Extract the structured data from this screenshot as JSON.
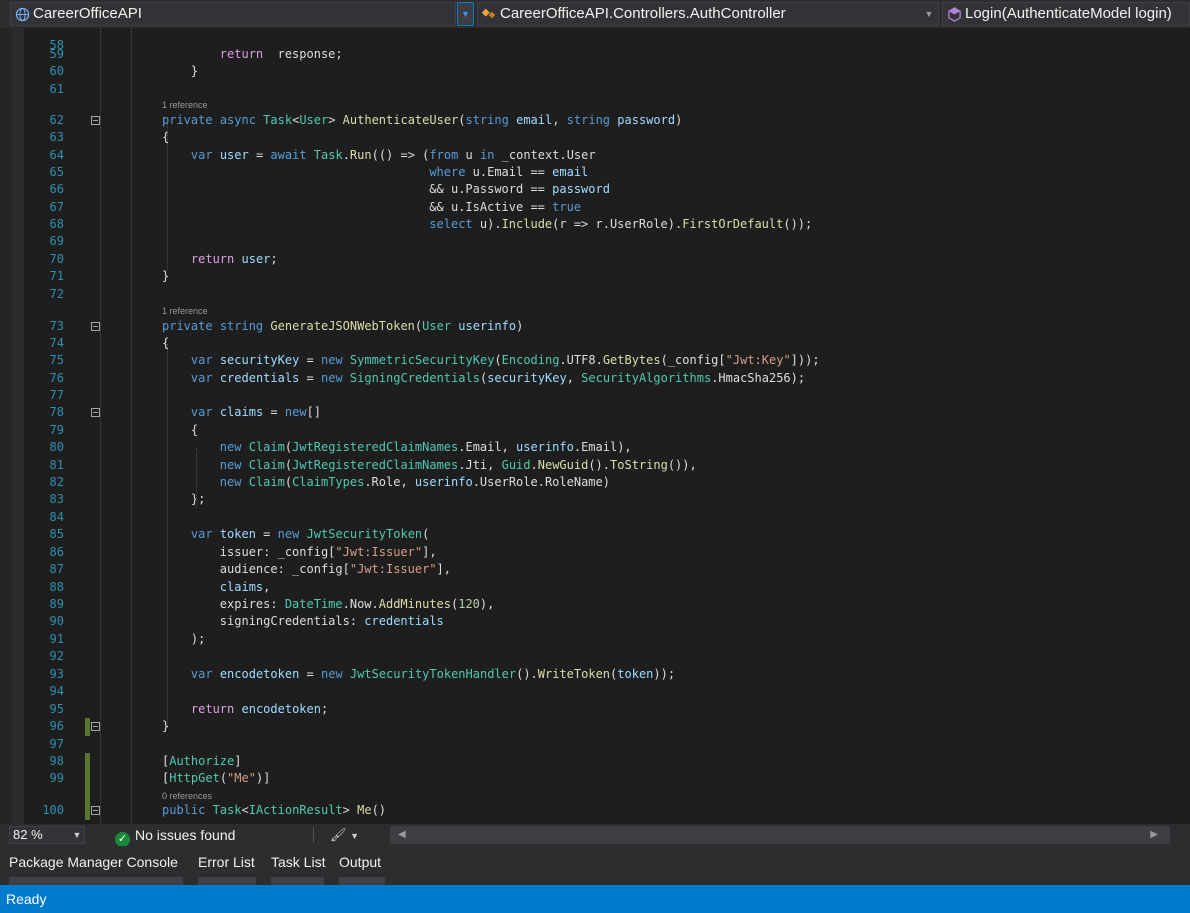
{
  "nav": {
    "project": "CareerOfficeAPI",
    "type": "CareerOfficeAPI.Controllers.AuthController",
    "member": "Login(AuthenticateModel login)"
  },
  "code_lines": [
    {
      "num": "58",
      "ref": "",
      "segs": []
    },
    {
      "num": "59",
      "ref": "",
      "segs": [
        [
          "ind",
          "        "
        ],
        [
          "ctl",
          "return"
        ],
        [
          "",
          "  response;"
        ]
      ]
    },
    {
      "num": "60",
      "ref": "",
      "segs": [
        [
          "",
          "    }"
        ]
      ]
    },
    {
      "num": "61",
      "ref": "",
      "segs": []
    },
    {
      "num": "62",
      "ref": "1 reference",
      "segs": [
        [
          "kw",
          "private"
        ],
        [
          "",
          " "
        ],
        [
          "kw",
          "async"
        ],
        [
          "",
          " "
        ],
        [
          "ty",
          "Task"
        ],
        [
          "",
          "<"
        ],
        [
          "ty",
          "User"
        ],
        [
          "",
          "> "
        ],
        [
          "fn",
          "AuthenticateUser"
        ],
        [
          "",
          "("
        ],
        [
          "kw",
          "string"
        ],
        [
          "",
          " "
        ],
        [
          "pr",
          "email"
        ],
        [
          "",
          ", "
        ],
        [
          "kw",
          "string"
        ],
        [
          "",
          " "
        ],
        [
          "pr",
          "password"
        ],
        [
          "",
          ")"
        ]
      ]
    },
    {
      "num": "63",
      "ref": "",
      "segs": [
        [
          "",
          "{"
        ]
      ]
    },
    {
      "num": "64",
      "ref": "",
      "segs": [
        [
          "",
          "    "
        ],
        [
          "kw",
          "var"
        ],
        [
          "",
          " "
        ],
        [
          "pr",
          "user"
        ],
        [
          "",
          " = "
        ],
        [
          "kw",
          "await"
        ],
        [
          "",
          " "
        ],
        [
          "ty",
          "Task"
        ],
        [
          "",
          "."
        ],
        [
          "fn",
          "Run"
        ],
        [
          "",
          "(() => ("
        ],
        [
          "kw",
          "from"
        ],
        [
          "",
          " u "
        ],
        [
          "kw",
          "in"
        ],
        [
          "",
          " _context.User"
        ]
      ]
    },
    {
      "num": "65",
      "ref": "",
      "segs": [
        [
          "",
          "                                     "
        ],
        [
          "kw",
          "where"
        ],
        [
          "",
          " u.Email == "
        ],
        [
          "pr",
          "email"
        ]
      ]
    },
    {
      "num": "66",
      "ref": "",
      "segs": [
        [
          "",
          "                                     && u.Password == "
        ],
        [
          "pr",
          "password"
        ]
      ]
    },
    {
      "num": "67",
      "ref": "",
      "segs": [
        [
          "",
          "                                     && u.IsActive == "
        ],
        [
          "kw",
          "true"
        ]
      ]
    },
    {
      "num": "68",
      "ref": "",
      "segs": [
        [
          "",
          "                                     "
        ],
        [
          "kw",
          "select"
        ],
        [
          "",
          " u)."
        ],
        [
          "fn",
          "Include"
        ],
        [
          "",
          "(r => r.UserRole)."
        ],
        [
          "fn",
          "FirstOrDefault"
        ],
        [
          "",
          "());"
        ]
      ]
    },
    {
      "num": "69",
      "ref": "",
      "segs": []
    },
    {
      "num": "70",
      "ref": "",
      "segs": [
        [
          "",
          "    "
        ],
        [
          "ctl",
          "return"
        ],
        [
          "",
          " "
        ],
        [
          "pr",
          "user"
        ],
        [
          "",
          ";"
        ]
      ]
    },
    {
      "num": "71",
      "ref": "",
      "segs": [
        [
          "",
          "}"
        ]
      ]
    },
    {
      "num": "72",
      "ref": "",
      "segs": []
    },
    {
      "num": "73",
      "ref": "1 reference",
      "segs": [
        [
          "kw",
          "private"
        ],
        [
          "",
          " "
        ],
        [
          "kw",
          "string"
        ],
        [
          "",
          " "
        ],
        [
          "fn",
          "GenerateJSONWebToken"
        ],
        [
          "",
          "("
        ],
        [
          "ty",
          "User"
        ],
        [
          "",
          " "
        ],
        [
          "pr",
          "userinfo"
        ],
        [
          "",
          ")"
        ]
      ]
    },
    {
      "num": "74",
      "ref": "",
      "segs": [
        [
          "",
          "{"
        ]
      ]
    },
    {
      "num": "75",
      "ref": "",
      "segs": [
        [
          "",
          "    "
        ],
        [
          "kw",
          "var"
        ],
        [
          "",
          " "
        ],
        [
          "pr",
          "securityKey"
        ],
        [
          "",
          " = "
        ],
        [
          "kw",
          "new"
        ],
        [
          "",
          " "
        ],
        [
          "ty",
          "SymmetricSecurityKey"
        ],
        [
          "",
          "("
        ],
        [
          "ty",
          "Encoding"
        ],
        [
          "",
          ".UTF8."
        ],
        [
          "fn",
          "GetBytes"
        ],
        [
          "",
          "(_config["
        ],
        [
          "st",
          "\"Jwt:Key\""
        ],
        [
          "",
          "]));"
        ]
      ]
    },
    {
      "num": "76",
      "ref": "",
      "segs": [
        [
          "",
          "    "
        ],
        [
          "kw",
          "var"
        ],
        [
          "",
          " "
        ],
        [
          "pr",
          "credentials"
        ],
        [
          "",
          " = "
        ],
        [
          "kw",
          "new"
        ],
        [
          "",
          " "
        ],
        [
          "ty",
          "SigningCredentials"
        ],
        [
          "",
          "("
        ],
        [
          "pr",
          "securityKey"
        ],
        [
          "",
          ", "
        ],
        [
          "ty",
          "SecurityAlgorithms"
        ],
        [
          "",
          ".HmacSha256);"
        ]
      ]
    },
    {
      "num": "77",
      "ref": "",
      "segs": []
    },
    {
      "num": "78",
      "ref": "",
      "segs": [
        [
          "",
          "    "
        ],
        [
          "kw",
          "var"
        ],
        [
          "",
          " "
        ],
        [
          "pr",
          "claims"
        ],
        [
          "",
          " = "
        ],
        [
          "kw",
          "new"
        ],
        [
          "",
          "[]"
        ]
      ]
    },
    {
      "num": "79",
      "ref": "",
      "segs": [
        [
          "",
          "    {"
        ]
      ]
    },
    {
      "num": "80",
      "ref": "",
      "segs": [
        [
          "",
          "        "
        ],
        [
          "kw",
          "new"
        ],
        [
          "",
          " "
        ],
        [
          "ty",
          "Claim"
        ],
        [
          "",
          "("
        ],
        [
          "ty",
          "JwtRegisteredClaimNames"
        ],
        [
          "",
          ".Email, "
        ],
        [
          "pr",
          "userinfo"
        ],
        [
          "",
          ".Email),"
        ]
      ]
    },
    {
      "num": "81",
      "ref": "",
      "segs": [
        [
          "",
          "        "
        ],
        [
          "kw",
          "new"
        ],
        [
          "",
          " "
        ],
        [
          "ty",
          "Claim"
        ],
        [
          "",
          "("
        ],
        [
          "ty",
          "JwtRegisteredClaimNames"
        ],
        [
          "",
          ".Jti, "
        ],
        [
          "ty",
          "Guid"
        ],
        [
          "",
          "."
        ],
        [
          "fn",
          "NewGuid"
        ],
        [
          "",
          "()."
        ],
        [
          "fn",
          "ToString"
        ],
        [
          "",
          "()),"
        ]
      ]
    },
    {
      "num": "82",
      "ref": "",
      "segs": [
        [
          "",
          "        "
        ],
        [
          "kw",
          "new"
        ],
        [
          "",
          " "
        ],
        [
          "ty",
          "Claim"
        ],
        [
          "",
          "("
        ],
        [
          "ty",
          "ClaimTypes"
        ],
        [
          "",
          ".Role, "
        ],
        [
          "pr",
          "userinfo"
        ],
        [
          "",
          ".UserRole.RoleName)"
        ]
      ]
    },
    {
      "num": "83",
      "ref": "",
      "segs": [
        [
          "",
          "    };"
        ]
      ]
    },
    {
      "num": "84",
      "ref": "",
      "segs": []
    },
    {
      "num": "85",
      "ref": "",
      "segs": [
        [
          "",
          "    "
        ],
        [
          "kw",
          "var"
        ],
        [
          "",
          " "
        ],
        [
          "pr",
          "token"
        ],
        [
          "",
          " = "
        ],
        [
          "kw",
          "new"
        ],
        [
          "",
          " "
        ],
        [
          "ty",
          "JwtSecurityToken"
        ],
        [
          "",
          "("
        ]
      ]
    },
    {
      "num": "86",
      "ref": "",
      "segs": [
        [
          "",
          "        issuer: _config["
        ],
        [
          "st",
          "\"Jwt:Issuer\""
        ],
        [
          "",
          "],"
        ]
      ]
    },
    {
      "num": "87",
      "ref": "",
      "segs": [
        [
          "",
          "        audience: _config["
        ],
        [
          "st",
          "\"Jwt:Issuer\""
        ],
        [
          "",
          "],"
        ]
      ]
    },
    {
      "num": "88",
      "ref": "",
      "segs": [
        [
          "",
          "        "
        ],
        [
          "pr",
          "claims"
        ],
        [
          "",
          ","
        ]
      ]
    },
    {
      "num": "89",
      "ref": "",
      "segs": [
        [
          "",
          "        expires: "
        ],
        [
          "ty",
          "DateTime"
        ],
        [
          "",
          ".Now."
        ],
        [
          "fn",
          "AddMinutes"
        ],
        [
          "",
          "("
        ],
        [
          "nm",
          "120"
        ],
        [
          "",
          "),"
        ]
      ]
    },
    {
      "num": "90",
      "ref": "",
      "segs": [
        [
          "",
          "        signingCredentials: "
        ],
        [
          "pr",
          "credentials"
        ]
      ]
    },
    {
      "num": "91",
      "ref": "",
      "segs": [
        [
          "",
          "    );"
        ]
      ]
    },
    {
      "num": "92",
      "ref": "",
      "segs": []
    },
    {
      "num": "93",
      "ref": "",
      "segs": [
        [
          "",
          "    "
        ],
        [
          "kw",
          "var"
        ],
        [
          "",
          " "
        ],
        [
          "pr",
          "encodetoken"
        ],
        [
          "",
          " = "
        ],
        [
          "kw",
          "new"
        ],
        [
          "",
          " "
        ],
        [
          "ty",
          "JwtSecurityTokenHandler"
        ],
        [
          "",
          "()."
        ],
        [
          "fn",
          "WriteToken"
        ],
        [
          "",
          "("
        ],
        [
          "pr",
          "token"
        ],
        [
          "",
          "));"
        ]
      ]
    },
    {
      "num": "94",
      "ref": "",
      "segs": []
    },
    {
      "num": "95",
      "ref": "",
      "segs": [
        [
          "",
          "    "
        ],
        [
          "ctl",
          "return"
        ],
        [
          "",
          " "
        ],
        [
          "pr",
          "encodetoken"
        ],
        [
          "",
          ";"
        ]
      ]
    },
    {
      "num": "96",
      "ref": "",
      "segs": [
        [
          "",
          "}"
        ]
      ]
    },
    {
      "num": "97",
      "ref": "",
      "segs": []
    },
    {
      "num": "98",
      "ref": "",
      "segs": [
        [
          "",
          "["
        ],
        [
          "ty",
          "Authorize"
        ],
        [
          "",
          "]"
        ]
      ]
    },
    {
      "num": "99",
      "ref": "",
      "segs": [
        [
          "",
          "["
        ],
        [
          "ty",
          "HttpGet"
        ],
        [
          "",
          "("
        ],
        [
          "st",
          "\"Me\""
        ],
        [
          "",
          ")]"
        ]
      ]
    },
    {
      "num": "100",
      "ref": "0 references",
      "segs": [
        [
          "kw",
          "public"
        ],
        [
          "",
          " "
        ],
        [
          "ty",
          "Task"
        ],
        [
          "",
          "<"
        ],
        [
          "ty",
          "IActionResult"
        ],
        [
          "",
          "> "
        ],
        [
          "fn",
          "Me"
        ],
        [
          "",
          "()"
        ]
      ]
    }
  ],
  "footer": {
    "zoom": "82 %",
    "issues": "No issues found"
  },
  "toolwindows": {
    "tabs": [
      "Package Manager Console",
      "Error List",
      "Task List",
      "Output"
    ]
  },
  "status": {
    "text": "Ready"
  },
  "colors": {
    "accent": "#007acc",
    "editor_bg": "#1e1e1e",
    "line_number": "#2b91af",
    "change_marker": "#577430",
    "keyword": "#569cd6",
    "type": "#4ec9b0",
    "method": "#dcdcaa",
    "string": "#d69d85",
    "control": "#d8a0df"
  }
}
